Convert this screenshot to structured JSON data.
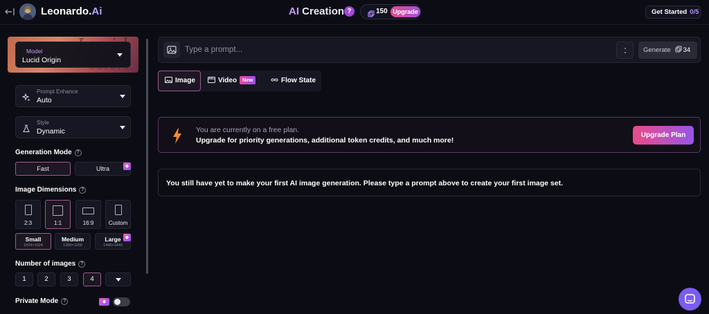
{
  "header": {
    "brand": "Leonardo.",
    "brand_accent": "Ai",
    "title_accent": "AI",
    "title": "Creation",
    "help": "?",
    "tokens": "150",
    "upgrade": "Upgrade",
    "get_started": "Get Started",
    "get_started_progress": "0/5"
  },
  "sidebar": {
    "model_label": "Model",
    "model_value": "Lucid Origin",
    "prompt_enhance_label": "Prompt Enhance",
    "prompt_enhance_value": "Auto",
    "style_label": "Style",
    "style_value": "Dynamic",
    "generation_mode_label": "Generation Mode",
    "generation_modes": [
      "Fast",
      "Ultra"
    ],
    "image_dimensions_label": "Image Dimensions",
    "aspect_ratios": [
      "2:3",
      "1:1",
      "16:9",
      "Custom"
    ],
    "sizes": [
      {
        "label": "Small",
        "res": "1024×1024"
      },
      {
        "label": "Medium",
        "res": "1200×1200"
      },
      {
        "label": "Large",
        "res": "1440×1440"
      }
    ],
    "number_label": "Number of images",
    "numbers": [
      "1",
      "2",
      "3",
      "4"
    ],
    "private_mode_label": "Private Mode",
    "private_mode_on": false
  },
  "prompt": {
    "placeholder": "Type a prompt...",
    "generate": "Generate",
    "cost": "34"
  },
  "tabs": [
    {
      "label": "Image",
      "active": true
    },
    {
      "label": "Video",
      "badge": "New"
    },
    {
      "label": "Flow State"
    }
  ],
  "banner": {
    "line1": "You are currently on a free plan.",
    "line2": "Upgrade for priority generations, additional token credits, and much more!",
    "button": "Upgrade Plan"
  },
  "empty_state": "You still have yet to make your first AI image generation. Please type a prompt above to create your first image set.",
  "colors": {
    "background": "#0c0d14",
    "accent": "#b48cff",
    "upgrade_gradient_start": "#ec4b86",
    "upgrade_gradient_end": "#9656e8",
    "chat": "#7a5cf0"
  }
}
